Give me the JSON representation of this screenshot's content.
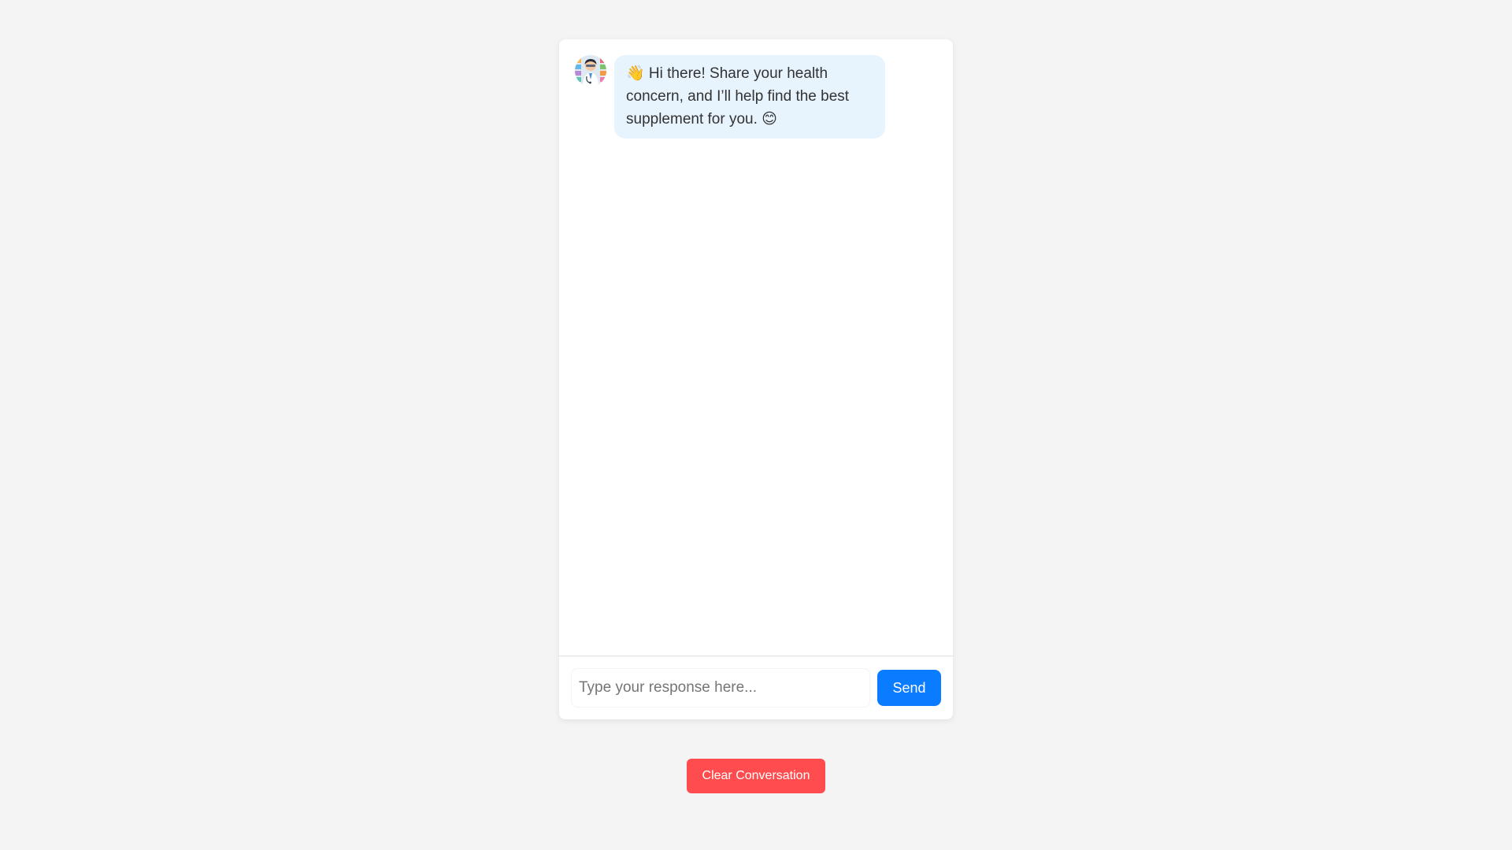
{
  "chat": {
    "messages": [
      {
        "sender": "assistant",
        "avatar_icon": "doctor-avatar-icon",
        "text": "👋 Hi there! Share your health concern, and I’ll help find the best supplement for you. 😊"
      }
    ],
    "input": {
      "value": "",
      "placeholder": "Type your response here..."
    },
    "send_label": "Send"
  },
  "actions": {
    "clear_label": "Clear Conversation"
  },
  "colors": {
    "page_background": "#f4f4f4",
    "bubble_background": "#e7f3fd",
    "send_button": "#0a7cff",
    "clear_button": "#ff4d4f"
  }
}
